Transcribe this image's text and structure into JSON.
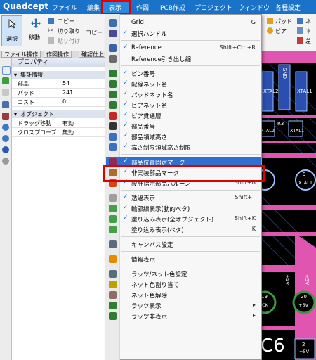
{
  "app": {
    "logo": "Quadcept"
  },
  "menubar": {
    "items": [
      "ファイル",
      "編集",
      "表示",
      "作図",
      "PCB作成",
      "プロジェクト",
      "ウィンドウ",
      "各種設定"
    ],
    "active": "表示"
  },
  "ribbon": {
    "select": "選択",
    "move": "移動",
    "copy": "コピー",
    "cut": "切り取り",
    "paste": "貼り付け",
    "copy2": "コピー",
    "pad": "パッド",
    "via": "ビア",
    "ne1": "ネ",
    "ne2": "ネ",
    "sa": "差"
  },
  "tabs": [
    "ファイル操作",
    "作図操作",
    "確認仕上"
  ],
  "property": {
    "title": "プロパティ",
    "section1": "集計情報",
    "rows": [
      {
        "k": "部品",
        "v": "54"
      },
      {
        "k": "パッド",
        "v": "241"
      },
      {
        "k": "コスト",
        "v": "0"
      }
    ],
    "section2": "オブジェクト",
    "rows2": [
      {
        "k": "ドラッグ移動",
        "v": "有効"
      },
      {
        "k": "クロスプローブ",
        "v": "無効"
      }
    ]
  },
  "board": {
    "labels": [
      "XTAL2",
      "GND",
      "XTAL1",
      "R3",
      "XTAL2",
      "XTAL1",
      "9",
      "XTAL1",
      "+5V",
      "+5V",
      "19",
      "SCK",
      "20",
      "+5V",
      "C6",
      "2",
      "+5V"
    ]
  },
  "dropdown": {
    "items": [
      {
        "label": "Grid",
        "shortcut": "G",
        "check": false,
        "icon": "grid-icon",
        "color": "#3a6fb0"
      },
      {
        "label": "選択ハンドル",
        "shortcut": "",
        "check": true,
        "icon": "handle-icon",
        "color": "#4a4a9a"
      },
      {
        "sep": true
      },
      {
        "label": "Reference",
        "shortcut": "Shift+Ctrl+R",
        "check": true,
        "icon": "reference-icon",
        "color": "#3b5fa8"
      },
      {
        "label": "Reference引き出し線",
        "shortcut": "",
        "check": false,
        "icon": "leader-icon",
        "color": "#6b6b6b"
      },
      {
        "sep": true
      },
      {
        "label": "ピン番号",
        "shortcut": "",
        "check": true,
        "icon": "pin-number-icon",
        "color": "#2e7d32"
      },
      {
        "label": "配線ネット名",
        "shortcut": "",
        "check": true,
        "icon": "net-name-icon",
        "color": "#2e7d32"
      },
      {
        "label": "パッドネット名",
        "shortcut": "",
        "check": true,
        "icon": "pad-net-icon",
        "color": "#2e7d32"
      },
      {
        "label": "ビアネット名",
        "shortcut": "",
        "check": true,
        "icon": "via-net-icon",
        "color": "#2e7d32"
      },
      {
        "label": "ビア貫通層",
        "shortcut": "",
        "check": true,
        "icon": "via-layer-icon",
        "color": "#c62828"
      },
      {
        "label": "部品番号",
        "shortcut": "",
        "check": true,
        "icon": "part-number-icon",
        "color": "#333333"
      },
      {
        "label": "部品領域高さ",
        "shortcut": "",
        "check": true,
        "icon": "part-height-icon",
        "color": "#3b6fbf"
      },
      {
        "label": "高さ制限領域高さ制限",
        "shortcut": "",
        "check": true,
        "icon": "height-limit-icon",
        "color": "#3b6fbf"
      },
      {
        "sep": true
      },
      {
        "label": "部品位置固定マーク",
        "shortcut": "",
        "check": true,
        "icon": "fix-mark-icon",
        "color": "#8e2a5a",
        "highlight": true
      },
      {
        "label": "非実装部品マーク",
        "shortcut": "",
        "check": true,
        "icon": "unmounted-icon",
        "color": "#b06a2a"
      },
      {
        "label": "設計指示部品バルーン",
        "shortcut": "Shift+B",
        "check": true,
        "icon": "balloon-icon",
        "color": "#d84315"
      },
      {
        "sep": true
      },
      {
        "label": "透過表示",
        "shortcut": "Shift+T",
        "check": true,
        "icon": "transparent-icon",
        "color": "#9e9e9e"
      },
      {
        "label": "輪郭線表示(動的ベタ)",
        "shortcut": "",
        "check": true,
        "icon": "outline-icon",
        "color": "#43a047"
      },
      {
        "label": "塗り込み表示(全オブジェクト)",
        "shortcut": "Shift+K",
        "check": true,
        "icon": "fill-all-icon",
        "color": "#43a047"
      },
      {
        "label": "塗り込み表示(ベタ)",
        "shortcut": "K",
        "check": false,
        "icon": "fill-beta-icon",
        "color": "#43a047"
      },
      {
        "sep": true
      },
      {
        "label": "キャンバス設定",
        "shortcut": "",
        "check": false,
        "icon": "canvas-icon",
        "color": "#5c6b7a"
      },
      {
        "sep": true
      },
      {
        "label": "情報表示",
        "shortcut": "",
        "check": false,
        "icon": "info-icon",
        "color": "#e68a00"
      },
      {
        "sep": true
      },
      {
        "label": "ラッツ/ネット色設定",
        "shortcut": "",
        "check": false,
        "icon": "ratsnest-color-icon",
        "color": "#546e7a"
      },
      {
        "label": "ネット色割り当て",
        "shortcut": "",
        "check": false,
        "icon": "net-color-assign-icon",
        "color": "#c0a000"
      },
      {
        "label": "ネット色解除",
        "shortcut": "",
        "check": false,
        "icon": "net-color-clear-icon",
        "color": "#8d6e63"
      },
      {
        "label": "ラッツ表示",
        "shortcut": "",
        "check": false,
        "icon": "ratsnest-show-icon",
        "color": "#2e7d32",
        "submenu": true
      },
      {
        "label": "ラッツ非表示",
        "shortcut": "",
        "check": false,
        "icon": "ratsnest-hide-icon",
        "color": "#2e7d32",
        "submenu": true
      }
    ]
  }
}
